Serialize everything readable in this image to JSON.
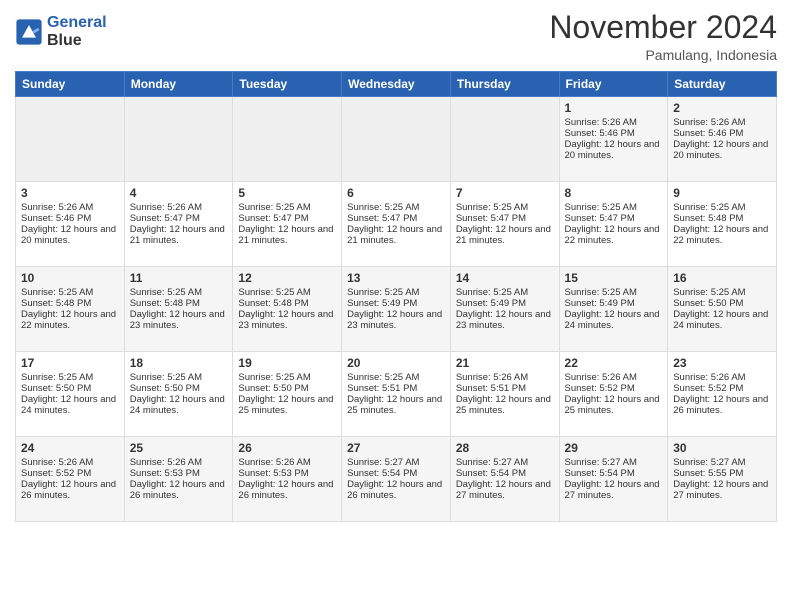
{
  "header": {
    "logo_line1": "General",
    "logo_line2": "Blue",
    "month": "November 2024",
    "location": "Pamulang, Indonesia"
  },
  "weekdays": [
    "Sunday",
    "Monday",
    "Tuesday",
    "Wednesday",
    "Thursday",
    "Friday",
    "Saturday"
  ],
  "weeks": [
    [
      {
        "day": "",
        "empty": true
      },
      {
        "day": "",
        "empty": true
      },
      {
        "day": "",
        "empty": true
      },
      {
        "day": "",
        "empty": true
      },
      {
        "day": "",
        "empty": true
      },
      {
        "day": "1",
        "sunrise": "Sunrise: 5:26 AM",
        "sunset": "Sunset: 5:46 PM",
        "daylight": "Daylight: 12 hours and 20 minutes."
      },
      {
        "day": "2",
        "sunrise": "Sunrise: 5:26 AM",
        "sunset": "Sunset: 5:46 PM",
        "daylight": "Daylight: 12 hours and 20 minutes."
      }
    ],
    [
      {
        "day": "3",
        "sunrise": "Sunrise: 5:26 AM",
        "sunset": "Sunset: 5:46 PM",
        "daylight": "Daylight: 12 hours and 20 minutes."
      },
      {
        "day": "4",
        "sunrise": "Sunrise: 5:26 AM",
        "sunset": "Sunset: 5:47 PM",
        "daylight": "Daylight: 12 hours and 21 minutes."
      },
      {
        "day": "5",
        "sunrise": "Sunrise: 5:25 AM",
        "sunset": "Sunset: 5:47 PM",
        "daylight": "Daylight: 12 hours and 21 minutes."
      },
      {
        "day": "6",
        "sunrise": "Sunrise: 5:25 AM",
        "sunset": "Sunset: 5:47 PM",
        "daylight": "Daylight: 12 hours and 21 minutes."
      },
      {
        "day": "7",
        "sunrise": "Sunrise: 5:25 AM",
        "sunset": "Sunset: 5:47 PM",
        "daylight": "Daylight: 12 hours and 21 minutes."
      },
      {
        "day": "8",
        "sunrise": "Sunrise: 5:25 AM",
        "sunset": "Sunset: 5:47 PM",
        "daylight": "Daylight: 12 hours and 22 minutes."
      },
      {
        "day": "9",
        "sunrise": "Sunrise: 5:25 AM",
        "sunset": "Sunset: 5:48 PM",
        "daylight": "Daylight: 12 hours and 22 minutes."
      }
    ],
    [
      {
        "day": "10",
        "sunrise": "Sunrise: 5:25 AM",
        "sunset": "Sunset: 5:48 PM",
        "daylight": "Daylight: 12 hours and 22 minutes."
      },
      {
        "day": "11",
        "sunrise": "Sunrise: 5:25 AM",
        "sunset": "Sunset: 5:48 PM",
        "daylight": "Daylight: 12 hours and 23 minutes."
      },
      {
        "day": "12",
        "sunrise": "Sunrise: 5:25 AM",
        "sunset": "Sunset: 5:48 PM",
        "daylight": "Daylight: 12 hours and 23 minutes."
      },
      {
        "day": "13",
        "sunrise": "Sunrise: 5:25 AM",
        "sunset": "Sunset: 5:49 PM",
        "daylight": "Daylight: 12 hours and 23 minutes."
      },
      {
        "day": "14",
        "sunrise": "Sunrise: 5:25 AM",
        "sunset": "Sunset: 5:49 PM",
        "daylight": "Daylight: 12 hours and 23 minutes."
      },
      {
        "day": "15",
        "sunrise": "Sunrise: 5:25 AM",
        "sunset": "Sunset: 5:49 PM",
        "daylight": "Daylight: 12 hours and 24 minutes."
      },
      {
        "day": "16",
        "sunrise": "Sunrise: 5:25 AM",
        "sunset": "Sunset: 5:50 PM",
        "daylight": "Daylight: 12 hours and 24 minutes."
      }
    ],
    [
      {
        "day": "17",
        "sunrise": "Sunrise: 5:25 AM",
        "sunset": "Sunset: 5:50 PM",
        "daylight": "Daylight: 12 hours and 24 minutes."
      },
      {
        "day": "18",
        "sunrise": "Sunrise: 5:25 AM",
        "sunset": "Sunset: 5:50 PM",
        "daylight": "Daylight: 12 hours and 24 minutes."
      },
      {
        "day": "19",
        "sunrise": "Sunrise: 5:25 AM",
        "sunset": "Sunset: 5:50 PM",
        "daylight": "Daylight: 12 hours and 25 minutes."
      },
      {
        "day": "20",
        "sunrise": "Sunrise: 5:25 AM",
        "sunset": "Sunset: 5:51 PM",
        "daylight": "Daylight: 12 hours and 25 minutes."
      },
      {
        "day": "21",
        "sunrise": "Sunrise: 5:26 AM",
        "sunset": "Sunset: 5:51 PM",
        "daylight": "Daylight: 12 hours and 25 minutes."
      },
      {
        "day": "22",
        "sunrise": "Sunrise: 5:26 AM",
        "sunset": "Sunset: 5:52 PM",
        "daylight": "Daylight: 12 hours and 25 minutes."
      },
      {
        "day": "23",
        "sunrise": "Sunrise: 5:26 AM",
        "sunset": "Sunset: 5:52 PM",
        "daylight": "Daylight: 12 hours and 26 minutes."
      }
    ],
    [
      {
        "day": "24",
        "sunrise": "Sunrise: 5:26 AM",
        "sunset": "Sunset: 5:52 PM",
        "daylight": "Daylight: 12 hours and 26 minutes."
      },
      {
        "day": "25",
        "sunrise": "Sunrise: 5:26 AM",
        "sunset": "Sunset: 5:53 PM",
        "daylight": "Daylight: 12 hours and 26 minutes."
      },
      {
        "day": "26",
        "sunrise": "Sunrise: 5:26 AM",
        "sunset": "Sunset: 5:53 PM",
        "daylight": "Daylight: 12 hours and 26 minutes."
      },
      {
        "day": "27",
        "sunrise": "Sunrise: 5:27 AM",
        "sunset": "Sunset: 5:54 PM",
        "daylight": "Daylight: 12 hours and 26 minutes."
      },
      {
        "day": "28",
        "sunrise": "Sunrise: 5:27 AM",
        "sunset": "Sunset: 5:54 PM",
        "daylight": "Daylight: 12 hours and 27 minutes."
      },
      {
        "day": "29",
        "sunrise": "Sunrise: 5:27 AM",
        "sunset": "Sunset: 5:54 PM",
        "daylight": "Daylight: 12 hours and 27 minutes."
      },
      {
        "day": "30",
        "sunrise": "Sunrise: 5:27 AM",
        "sunset": "Sunset: 5:55 PM",
        "daylight": "Daylight: 12 hours and 27 minutes."
      }
    ]
  ]
}
